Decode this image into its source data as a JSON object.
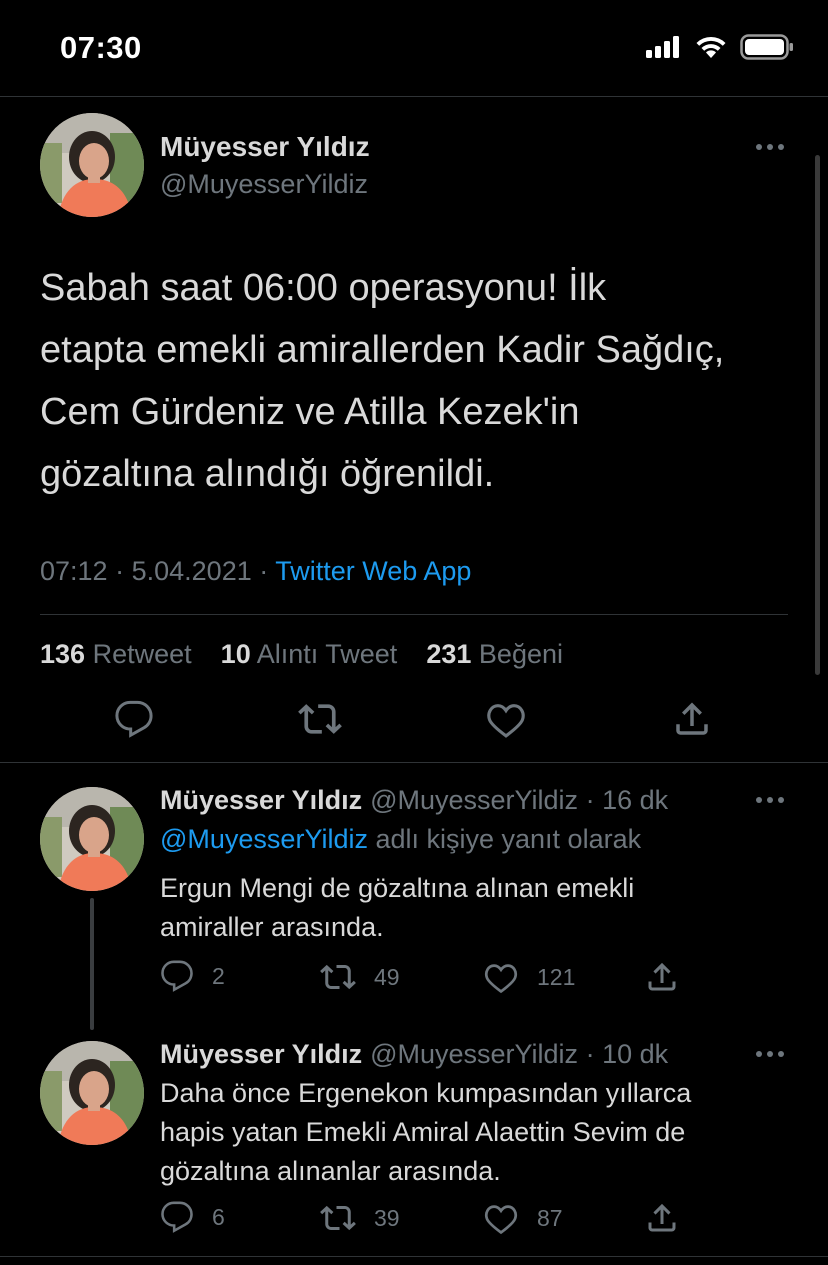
{
  "status_bar": {
    "time": "07:30"
  },
  "main_tweet": {
    "author_name": "Müyesser Yıldız",
    "author_handle": "@MuyesserYildiz",
    "text_lines": [
      "Sabah saat 06:00 operasyonu! İlk",
      "etapta emekli amirallerden Kadir Sağdıç,",
      "Cem Gürdeniz ve Atilla Kezek'in",
      "gözaltına alındığı öğrenildi."
    ],
    "time": "07:12",
    "date": "5.04.2021",
    "separator": "·",
    "app": "Twitter Web App",
    "stats": {
      "retweets": "136",
      "retweets_label": "Retweet",
      "quotes": "10",
      "quotes_label": "Alıntı Tweet",
      "likes": "231",
      "likes_label": "Beğeni"
    }
  },
  "replies": [
    {
      "author_name": "Müyesser Yıldız",
      "author_handle": "@MuyesserYildiz",
      "time_ago": "· 16 dk",
      "reply_to_mention": "@MuyesserYildiz",
      "reply_to_suffix": " adlı kişiye yanıt olarak",
      "text_lines": [
        "Ergun Mengi de gözaltına alınan emekli",
        "amiraller arasında."
      ],
      "reply_count": "2",
      "retweet_count": "49",
      "like_count": "121"
    },
    {
      "author_name": "Müyesser Yıldız",
      "author_handle": "@MuyesserYildiz",
      "time_ago": "· 10 dk",
      "text_lines": [
        "Daha önce Ergenekon kumpasından yıllarca",
        "hapis yatan Emekli Amiral Alaettin Sevim de",
        "gözaltına alınanlar arasında."
      ],
      "reply_count": "6",
      "retweet_count": "39",
      "like_count": "87"
    }
  ],
  "colors": {
    "background": "#000000",
    "text": "#d9d9d9",
    "muted": "#6e767d",
    "link": "#1d9bf0",
    "divider": "#2f3336"
  },
  "icons": [
    "signal-icon",
    "wifi-icon",
    "battery-icon",
    "more-icon",
    "reply-icon",
    "retweet-icon",
    "like-icon",
    "share-icon"
  ]
}
